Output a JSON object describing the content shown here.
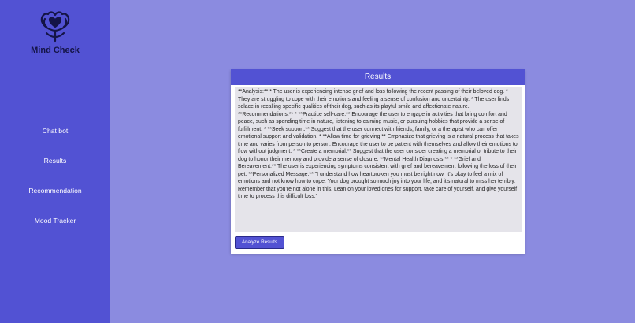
{
  "brand": {
    "name": "Mind Check",
    "logo_icon": "head-heart-icon"
  },
  "nav": {
    "items": [
      {
        "label": "Chat bot"
      },
      {
        "label": "Results"
      },
      {
        "label": "Recommendation"
      },
      {
        "label": "Mood Tracker"
      }
    ]
  },
  "results": {
    "title": "Results",
    "text": "**Analysis:** * The user is experiencing intense grief and loss following the recent passing of their beloved dog. * They are struggling to cope with their emotions and feeling a sense of confusion and uncertainty. * The user finds solace in recalling specific qualities of their dog, such as its playful smile and affectionate nature. **Recommendations:** * **Practice self-care:** Encourage the user to engage in activities that bring comfort and peace, such as spending time in nature, listening to calming music, or pursuing hobbies that provide a sense of fulfillment. * **Seek support:** Suggest that the user connect with friends, family, or a therapist who can offer emotional support and validation. * **Allow time for grieving:** Emphasize that grieving is a natural process that takes time and varies from person to person. Encourage the user to be patient with themselves and allow their emotions to flow without judgment. * **Create a memorial:** Suggest that the user consider creating a memorial or tribute to their dog to honor their memory and provide a sense of closure. **Mental Health Diagnosis:** * **Grief and Bereavement:** The user is experiencing symptoms consistent with grief and bereavement following the loss of their pet. **Personalized Message:** \"I understand how heartbroken you must be right now. It's okay to feel a mix of emotions and not know how to cope. Your dog brought so much joy into your life, and it's natural to miss her terribly. Remember that you're not alone in this. Lean on your loved ones for support, take care of yourself, and give yourself time to process this difficult loss.\"",
    "button_label": "Analyze Results"
  },
  "colors": {
    "background": "#8b8be0",
    "sidebar": "#5252d3",
    "header": "#5252d3",
    "text_box": "#e5e4ea"
  }
}
